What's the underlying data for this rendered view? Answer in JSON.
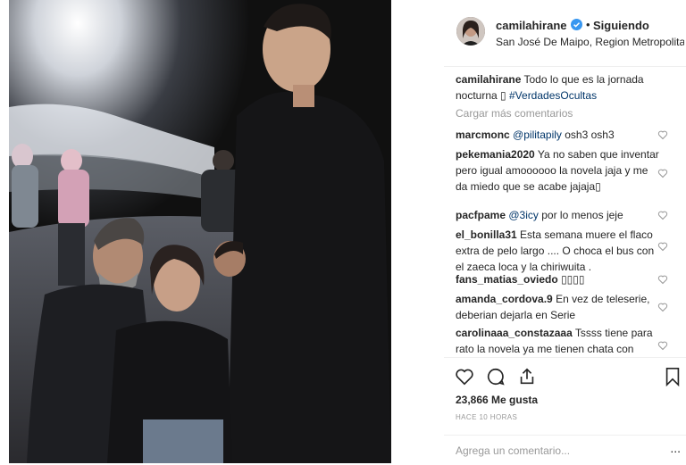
{
  "post": {
    "username": "camilahirane",
    "follow_status": "Siguiendo",
    "dot": "•",
    "location": "San José De Maipo, Region Metropolitana,...",
    "more_icon": "more-dots-icon"
  },
  "caption": {
    "username": "camilahirane",
    "text": "Todo lo que es la jornada nocturna",
    "glyph": "▯",
    "hashtag": "#VerdadesOcultas"
  },
  "load_more": "Cargar más comentarios",
  "comments": [
    {
      "user": "marcmonc",
      "mention": "@pilitapily",
      "text": " osh3 osh3"
    },
    {
      "user": "pekemania2020",
      "mention": "",
      "text": "Ya no saben que inventar pero igual amoooooo la novela jaja y me da miedo que se acabe jajaja▯"
    },
    {
      "user": "pacfpame",
      "mention": "@3icy",
      "text": " por lo menos jeje"
    },
    {
      "user": "el_bonilla31",
      "mention": "",
      "text": "Esta semana muere el flaco extra de pelo largo .... O choca el bus con el zaeca loca y la chiriwuita ."
    },
    {
      "user": "fans_matias_oviedo",
      "mention": "",
      "text": "▯▯▯▯"
    },
    {
      "user": "amanda_cordova.9",
      "mention": "",
      "text": "En vez de teleserie, deberian dejarla en Serie"
    },
    {
      "user": "carolinaaa_constazaaa",
      "mention": "",
      "text": "Tssss tiene para rato la novela ya me tienen chata con"
    }
  ],
  "likes": "23,866 Me gusta",
  "timestamp": "HACE 10 HORAS",
  "add_comment_placeholder": "Agrega un comentario...",
  "more_label": "...",
  "colors": {
    "accent": "#3897f0",
    "link": "#003569",
    "muted": "#999999"
  }
}
